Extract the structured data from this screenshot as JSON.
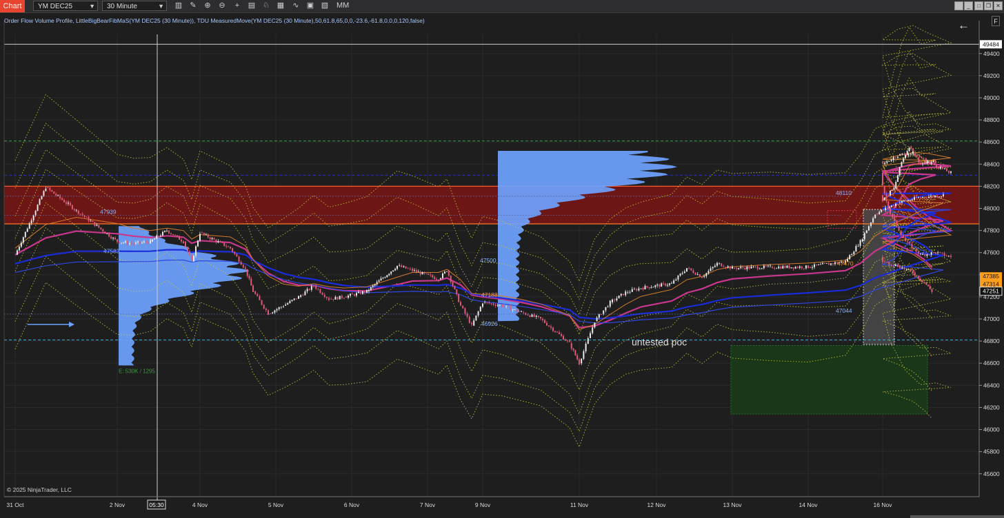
{
  "toolbar": {
    "tab_label": "Chart",
    "instrument": "YM DEC25",
    "interval": "30 Minute",
    "mm_label": "MM",
    "icons": [
      "bar-type-icon",
      "pencil-icon",
      "zoom-in-icon",
      "zoom-out-icon",
      "crosshair-icon",
      "data-box-icon",
      "strategies-icon",
      "chart-trader-icon",
      "indicators-icon",
      "properties-icon",
      "templates-icon"
    ]
  },
  "indicator_header": "Order Flow Volume Profile, LittleBigBearFibMaS(YM DEC25 (30 Minute)), TDU MeasuredMove(YM DEC25 (30 Minute),50,61.8,65,0,0,-23.6,-61.8,0,0,0,120,false)",
  "copyright": "© 2025 NinjaTrader, LLC",
  "annotation": "untested poc",
  "side_button": "F",
  "colors": {
    "background": "#1e1e1e",
    "up_candle": "#e8e8e8",
    "down_candle": "#e05a78",
    "profile": "#6fa3ff",
    "resistance_zone": "#7a1515",
    "support_zone": "#1a3a1a",
    "poc_line": "#2fb4e8",
    "vwap_blue": "#1a2bd8",
    "ma_magenta": "#c8378c",
    "fib_yellow": "#c8c83c",
    "last_price": "#ffffff",
    "orange_label": "#ff9e1a"
  },
  "chart_data": {
    "type": "candlestick",
    "instrument": "YM DEC25",
    "interval": "30 Minute",
    "y_axis": {
      "ylim": [
        45393,
        49573
      ],
      "ticks": [
        45600,
        45800,
        46000,
        46200,
        46400,
        46600,
        46800,
        47000,
        47200,
        47400,
        47600,
        47800,
        48000,
        48200,
        48400,
        48600,
        48800,
        49000,
        49200,
        49400
      ]
    },
    "x_axis": {
      "labels": [
        "31 Oct",
        "2 Nov",
        "4 Nov",
        "5 Nov",
        "6 Nov",
        "7 Nov",
        "9 Nov",
        "11 Nov",
        "12 Nov",
        "13 Nov",
        "14 Nov",
        "16 Nov"
      ],
      "crosshair_time": "05:30"
    },
    "crosshair_price": 49484,
    "price_path": [
      [
        0,
        47580
      ],
      [
        0.3,
        48190
      ],
      [
        0.6,
        47980
      ],
      [
        1,
        47700
      ],
      [
        1.2,
        47680
      ],
      [
        1.4,
        47700
      ],
      [
        1.6,
        47800
      ],
      [
        1.8,
        47700
      ],
      [
        1.9,
        47520
      ],
      [
        2,
        47780
      ],
      [
        2.4,
        47640
      ],
      [
        2.6,
        47450
      ],
      [
        2.7,
        47250
      ],
      [
        2.9,
        47050
      ],
      [
        3.1,
        47120
      ],
      [
        3.3,
        47200
      ],
      [
        3.5,
        47300
      ],
      [
        3.7,
        47180
      ],
      [
        3.9,
        47200
      ],
      [
        4.2,
        47250
      ],
      [
        4.6,
        47480
      ],
      [
        4.8,
        47440
      ],
      [
        5.2,
        47360
      ],
      [
        5.35,
        47440
      ],
      [
        5.6,
        47120
      ],
      [
        5.8,
        46940
      ],
      [
        6.0,
        47150
      ],
      [
        6.2,
        47120
      ],
      [
        6.4,
        47060
      ],
      [
        6.6,
        47000
      ],
      [
        6.9,
        46780
      ],
      [
        7.0,
        46600
      ],
      [
        7.2,
        46980
      ],
      [
        7.4,
        47150
      ],
      [
        7.6,
        47240
      ],
      [
        7.8,
        47280
      ],
      [
        8.2,
        47320
      ],
      [
        8.4,
        47460
      ],
      [
        8.6,
        47380
      ],
      [
        8.8,
        47500
      ],
      [
        9.0,
        47460
      ],
      [
        9.5,
        47470
      ],
      [
        10.0,
        47470
      ],
      [
        10.5,
        47520
      ],
      [
        10.7,
        47700
      ],
      [
        10.9,
        47950
      ],
      [
        11.2,
        48050
      ],
      [
        11.5,
        48100
      ],
      [
        11.8,
        48120
      ],
      [
        12.0,
        48080
      ],
      [
        12.15,
        48180
      ],
      [
        12.25,
        48420
      ],
      [
        12.35,
        48560
      ],
      [
        12.5,
        48400
      ],
      [
        12.7,
        48420
      ],
      [
        13.0,
        48400
      ],
      [
        13.2,
        48480
      ],
      [
        13.4,
        48500
      ],
      [
        13.6,
        48420
      ],
      [
        13.9,
        48320
      ],
      [
        14.0,
        48200
      ],
      [
        14.1,
        47950
      ],
      [
        14.3,
        47700
      ],
      [
        14.5,
        47580
      ],
      [
        14.7,
        47600
      ],
      [
        14.9,
        47560
      ],
      [
        15.0,
        47520
      ],
      [
        15.2,
        47480
      ],
      [
        15.4,
        47420
      ],
      [
        15.55,
        47330
      ],
      [
        15.65,
        47250
      ]
    ],
    "horizontal_lines": [
      {
        "price": 48610,
        "style": "dashed",
        "color": "#2e9e3a"
      },
      {
        "price": 48300,
        "style": "dashed",
        "color": "#1f2fd8"
      },
      {
        "price": 48200,
        "style": "solid",
        "color": "#ff5a2a"
      },
      {
        "price": 47860,
        "style": "solid",
        "color": "#ff7a2a"
      },
      {
        "price": 46810,
        "style": "dashed",
        "color": "#2fb4e8"
      }
    ],
    "level_labels": [
      {
        "text": "47939",
        "price": 47939
      },
      {
        "text": "47583",
        "price": 47583
      },
      {
        "text": "47500",
        "price": 47500
      },
      {
        "text": "47188",
        "price": 47188
      },
      {
        "text": "46926",
        "price": 46926
      },
      {
        "text": "48110",
        "price": 48110
      },
      {
        "text": "47470",
        "price": 47470
      },
      {
        "text": "47044",
        "price": 47044
      }
    ],
    "profile_footer": "E: 530K / 1295",
    "price_labels": [
      {
        "text": "49484",
        "price": 49484,
        "style": "white"
      },
      {
        "text": "47385",
        "price": 47385,
        "style": "orange"
      },
      {
        "text": "47314",
        "price": 47314,
        "style": "orange"
      },
      {
        "text": "47251",
        "price": 47251,
        "style": "current"
      }
    ]
  }
}
